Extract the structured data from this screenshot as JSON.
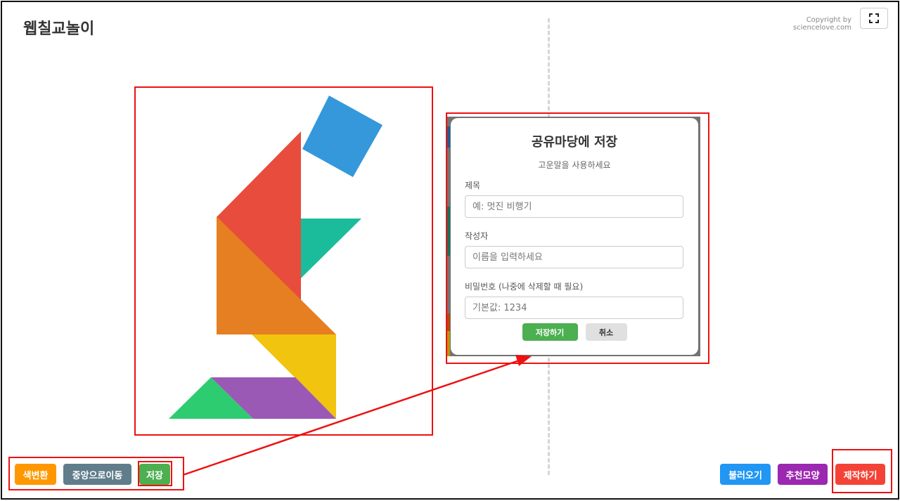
{
  "app": {
    "title": "웹칠교놀이",
    "copyright": "Copyright by sciencelove.com",
    "fullscreen_icon": "fullscreen-icon"
  },
  "tangram": {
    "pieces": [
      {
        "name": "blue-square",
        "color": "#3498db"
      },
      {
        "name": "red-large-triangle",
        "color": "#e74c3c"
      },
      {
        "name": "teal-small-triangle",
        "color": "#1abc9c"
      },
      {
        "name": "orange-large-triangle",
        "color": "#e67e22"
      },
      {
        "name": "yellow-medium-triangle",
        "color": "#f1c40f"
      },
      {
        "name": "green-small-triangle",
        "color": "#2ecc71"
      },
      {
        "name": "purple-parallelogram",
        "color": "#9b59b6"
      }
    ]
  },
  "save_dialog": {
    "title": "공유마당에 저장",
    "subtitle": "고운말을 사용하세요",
    "fields": {
      "title_label": "제목",
      "title_placeholder": "예: 멋진 비행기",
      "author_label": "작성자",
      "author_placeholder": "이름을 입력하세요",
      "password_label": "비밀번호 (나중에 삭제할 때 필요)",
      "password_placeholder": "기본값: 1234"
    },
    "save_button": "저장하기",
    "cancel_button": "취소"
  },
  "toolbar_left": {
    "color_change": "색변환",
    "center_move": "중앙으로이동",
    "save": "저장"
  },
  "toolbar_right": {
    "load": "불러오기",
    "recommend": "추천모양",
    "make": "제작하기"
  },
  "colors": {
    "annotation": "#ee1111",
    "orange_button": "#ff9800",
    "gray_button": "#607d8b",
    "green_button": "#4caf50",
    "blue_button": "#2196f3",
    "purple_button": "#9c27b0",
    "red_button": "#f44336"
  }
}
